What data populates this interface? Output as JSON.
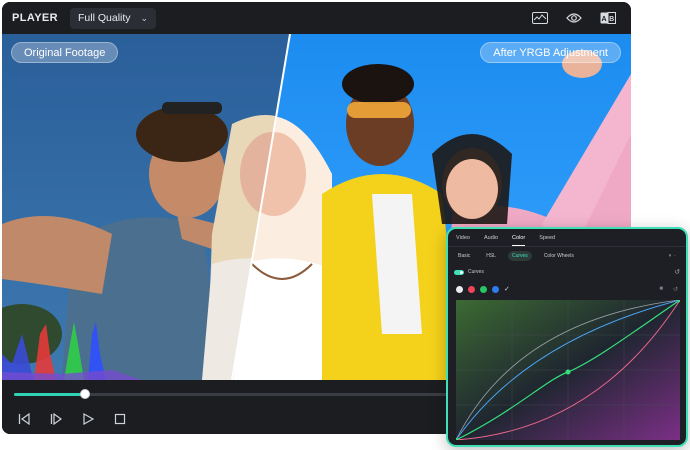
{
  "player": {
    "title": "PLAYER",
    "quality": "Full Quality",
    "icons": [
      "waveform-icon",
      "eye-icon",
      "compare-ab-icon"
    ]
  },
  "frame": {
    "left_label": "Original Footage",
    "right_label": "After YRGB Adjustment"
  },
  "playback": {
    "progress": 0.118,
    "buttons": [
      "prev-frame-icon",
      "next-frame-icon",
      "play-icon",
      "stop-icon"
    ]
  },
  "color_panel": {
    "tabs": [
      "Video",
      "Audio",
      "Color",
      "Speed"
    ],
    "active_tab": "Color",
    "subtabs": [
      "Basic",
      "HSL",
      "Curves",
      "Color Wheels"
    ],
    "active_subtab": "Curves",
    "curves_label": "Curves",
    "channels": [
      "white",
      "red",
      "green",
      "blue"
    ],
    "colors": {
      "accent": "#3fe0b8",
      "green_curve": "#35e07a",
      "blue_curve": "#4aa8ff",
      "red_curve": "#f06a8a"
    }
  }
}
